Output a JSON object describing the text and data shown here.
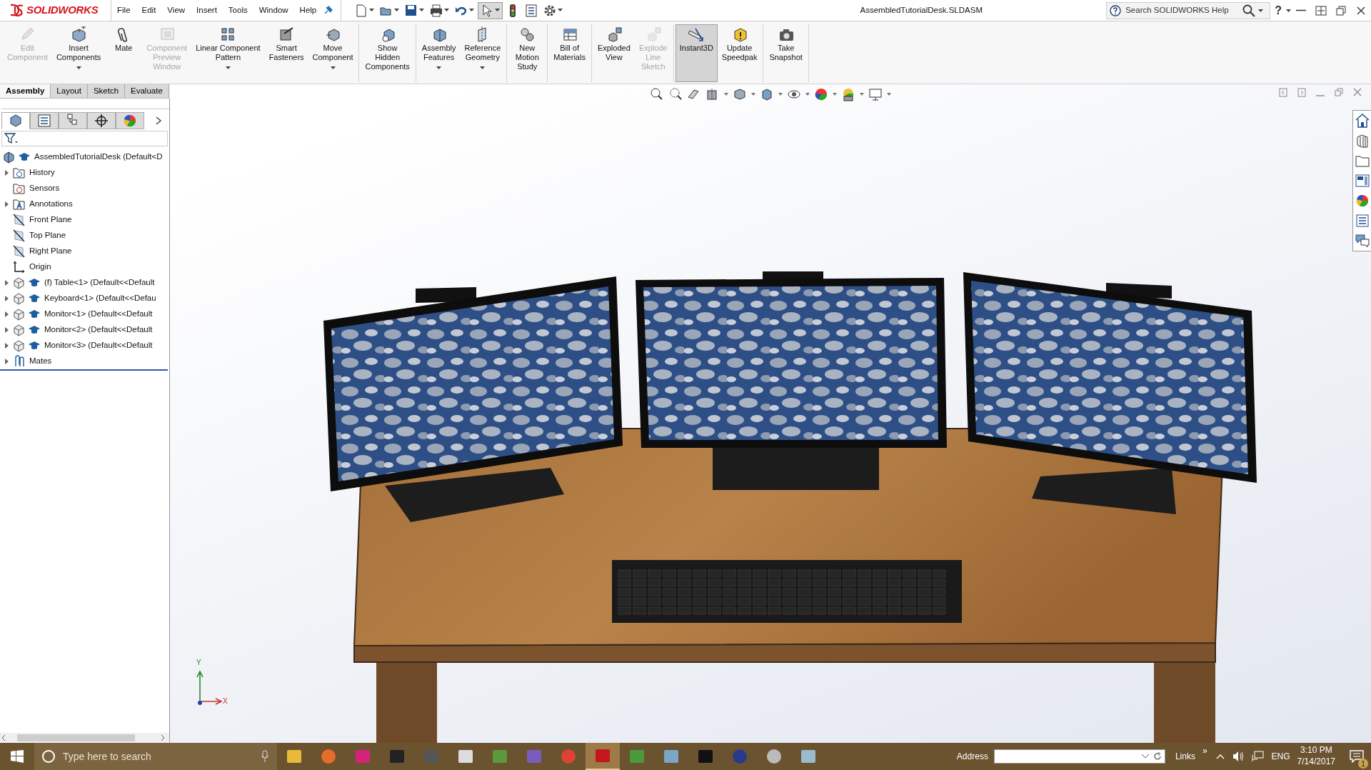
{
  "app": {
    "logo": "SOLIDWORKS",
    "menu": [
      "File",
      "Edit",
      "View",
      "Insert",
      "Tools",
      "Window",
      "Help"
    ],
    "title": "AssembledTutorialDesk.SLDASM",
    "search": {
      "placeholder": "Search SOLIDWORKS Help"
    },
    "help": "?"
  },
  "ribbon": {
    "groups": [
      [
        {
          "label": "Edit\nComponent",
          "disabled": true,
          "selected": false,
          "dropdown": false
        },
        {
          "label": "Insert\nComponents",
          "disabled": false,
          "selected": false,
          "dropdown": true
        },
        {
          "label": "Mate",
          "disabled": false,
          "selected": false,
          "dropdown": false
        },
        {
          "label": "Component\nPreview\nWindow",
          "disabled": true,
          "selected": false,
          "dropdown": false
        },
        {
          "label": "Linear Component\nPattern",
          "disabled": false,
          "selected": false,
          "dropdown": true
        },
        {
          "label": "Smart\nFasteners",
          "disabled": false,
          "selected": false,
          "dropdown": false
        },
        {
          "label": "Move\nComponent",
          "disabled": false,
          "selected": false,
          "dropdown": true
        }
      ],
      [
        {
          "label": "Show\nHidden\nComponents",
          "disabled": false,
          "selected": false,
          "dropdown": false
        }
      ],
      [
        {
          "label": "Assembly\nFeatures",
          "disabled": false,
          "selected": false,
          "dropdown": true
        },
        {
          "label": "Reference\nGeometry",
          "disabled": false,
          "selected": false,
          "dropdown": true
        }
      ],
      [
        {
          "label": "New\nMotion\nStudy",
          "disabled": false,
          "selected": false,
          "dropdown": false
        }
      ],
      [
        {
          "label": "Bill of\nMaterials",
          "disabled": false,
          "selected": false,
          "dropdown": false
        }
      ],
      [
        {
          "label": "Exploded\nView",
          "disabled": false,
          "selected": false,
          "dropdown": false
        },
        {
          "label": "Explode\nLine\nSketch",
          "disabled": true,
          "selected": false,
          "dropdown": false
        }
      ],
      [
        {
          "label": "Instant3D",
          "disabled": false,
          "selected": true,
          "dropdown": false
        },
        {
          "label": "Update\nSpeedpak",
          "disabled": false,
          "selected": false,
          "dropdown": false
        }
      ],
      [
        {
          "label": "Take\nSnapshot",
          "disabled": false,
          "selected": false,
          "dropdown": false
        }
      ]
    ]
  },
  "tabs": [
    {
      "label": "Assembly",
      "selected": true
    },
    {
      "label": "Layout",
      "selected": false
    },
    {
      "label": "Sketch",
      "selected": false
    },
    {
      "label": "Evaluate",
      "selected": false
    }
  ],
  "panel_tabs": [
    {
      "selected": true
    },
    {
      "selected": false
    },
    {
      "selected": false
    },
    {
      "selected": false
    },
    {
      "selected": false
    }
  ],
  "tree": {
    "label": "AssembledTutorialDesk (Default<D",
    "kind": "assembly",
    "children": [
      {
        "label": "History",
        "kind": "history",
        "expanded": false
      },
      {
        "label": "Sensors",
        "kind": "sensors"
      },
      {
        "label": "Annotations",
        "kind": "annotations",
        "expanded": false
      },
      {
        "label": "Front Plane",
        "kind": "plane"
      },
      {
        "label": "Top Plane",
        "kind": "plane"
      },
      {
        "label": "Right Plane",
        "kind": "plane"
      },
      {
        "label": "Origin",
        "kind": "origin"
      },
      {
        "label": "(f) Table<1> (Default<<Default",
        "kind": "part",
        "expanded": false
      },
      {
        "label": "Keyboard<1> (Default<<Defau",
        "kind": "part",
        "expanded": false
      },
      {
        "label": "Monitor<1> (Default<<Default",
        "kind": "part",
        "expanded": false
      },
      {
        "label": "Monitor<2> (Default<<Default",
        "kind": "part",
        "expanded": false
      },
      {
        "label": "Monitor<3> (Default<<Default",
        "kind": "part",
        "expanded": false
      },
      {
        "label": "Mates",
        "kind": "mates",
        "expanded": false
      }
    ]
  },
  "triad": {
    "x": "X",
    "y": "Y"
  },
  "taskbar": {
    "search": {
      "placeholder": "Type here to search"
    },
    "apps": [
      {
        "selected": false
      },
      {
        "selected": false
      },
      {
        "selected": false
      },
      {
        "selected": false
      },
      {
        "selected": false
      },
      {
        "selected": false
      },
      {
        "selected": false
      },
      {
        "selected": false
      },
      {
        "selected": false
      },
      {
        "selected": true
      },
      {
        "selected": false
      },
      {
        "selected": false
      },
      {
        "selected": false
      },
      {
        "selected": false
      },
      {
        "selected": false
      },
      {
        "selected": false
      }
    ],
    "address_label": "Address",
    "links": "Links",
    "chevron": "»",
    "language": "ENG",
    "time": "3:10 PM",
    "date": "7/14/2017",
    "notifications": "1"
  }
}
